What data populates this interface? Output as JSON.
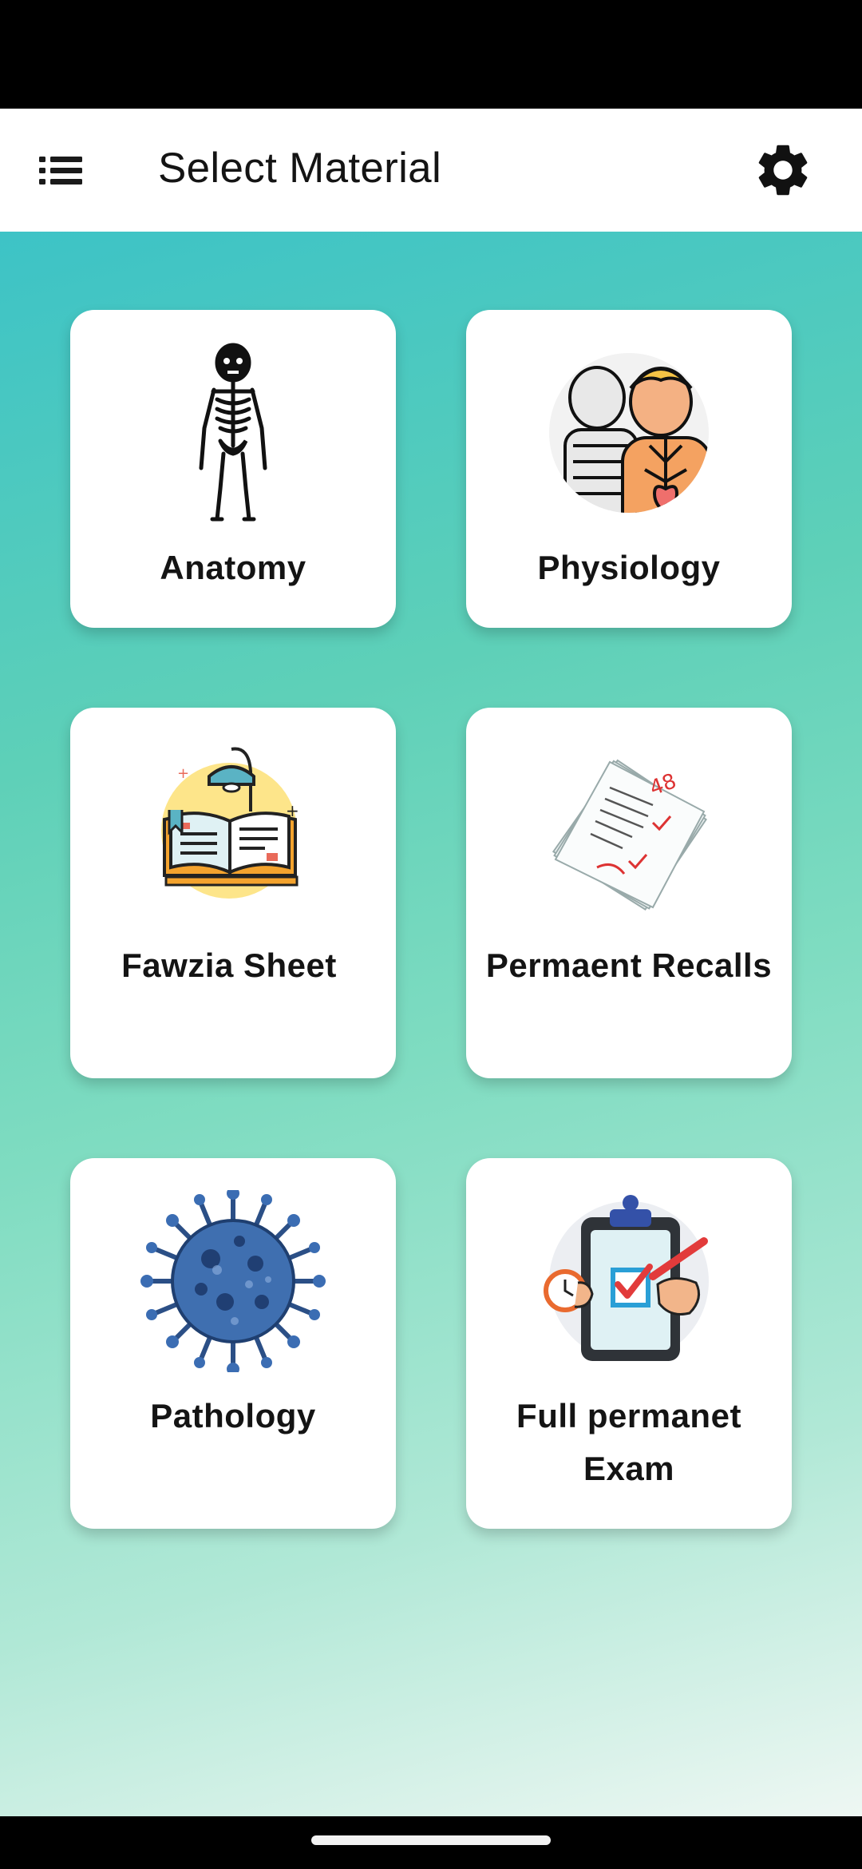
{
  "app_bar": {
    "title": "Select Material",
    "menu_icon": "list-menu-icon",
    "settings_icon": "gear-icon"
  },
  "materials": [
    {
      "label": "Anatomy",
      "icon": "skeleton-icon"
    },
    {
      "label": "Physiology",
      "icon": "human-body-icon"
    },
    {
      "label": "Fawzia Sheet",
      "icon": "open-book-lamp-icon"
    },
    {
      "label": "Permaent Recalls",
      "icon": "exam-papers-icon"
    },
    {
      "label": "Pathology",
      "icon": "virus-icon"
    },
    {
      "label": "Full permanet Exam",
      "icon": "clipboard-check-icon"
    }
  ],
  "colors": {
    "gradient_top": "#3dc3c6",
    "gradient_bottom": "#eef7f3",
    "card": "#ffffff",
    "text": "#141414"
  }
}
